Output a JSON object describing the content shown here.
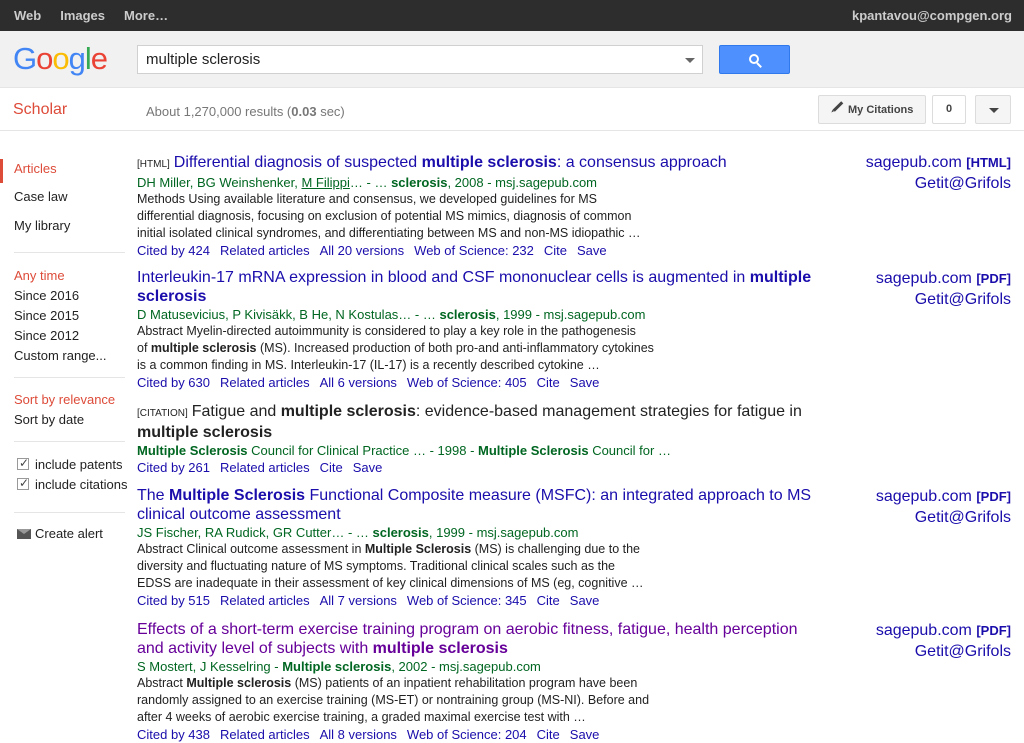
{
  "topbar": {
    "nav": [
      "Web",
      "Images",
      "More…"
    ],
    "user": "kpantavou@compgen.org"
  },
  "logo": {
    "letters": [
      "G",
      "o",
      "o",
      "g",
      "l",
      "e"
    ]
  },
  "search": {
    "value": "multiple sclerosis"
  },
  "scholar": {
    "title": "Scholar",
    "count_prefix": "About 1,270,000 results (",
    "count_time": "0.03",
    "count_suffix": " sec)",
    "my_citations": "My Citations",
    "counter": "0"
  },
  "sidebar": {
    "types": [
      "Articles",
      "Case law",
      "My library"
    ],
    "time": [
      "Any time",
      "Since 2016",
      "Since 2015",
      "Since 2012",
      "Custom range..."
    ],
    "sort": [
      "Sort by relevance",
      "Sort by date"
    ],
    "checks": [
      "include patents",
      "include citations"
    ],
    "alert": "Create alert"
  },
  "results": [
    {
      "tag": "[HTML]",
      "title_parts": [
        "Differential diagnosis of suspected ",
        "multiple sclerosis",
        ": a consensus approach"
      ],
      "authors_parts": [
        "DH Miller, BG Weinshenker, ",
        "M Filippi",
        "… - … ",
        "sclerosis",
        ", 2008 - msj.sagepub.com"
      ],
      "snippet_lines": [
        "Methods Using available literature and consensus, we developed guidelines for MS",
        "differential diagnosis, focusing on exclusion of potential MS mimics, diagnosis of common",
        "initial isolated clinical syndromes, and differentiating between MS and non-MS idiopathic …"
      ],
      "links": [
        "Cited by 424",
        "Related articles",
        "All 20 versions",
        "Web of Science: 232",
        "Cite",
        "Save"
      ],
      "side_source": "sagepub.com",
      "side_format": "[HTML]",
      "side_getit": "Getit@Grifols"
    },
    {
      "tag": "",
      "title_line1": [
        "Interleukin-17 mRNA expression in blood and CSF mononuclear cells is augmented in ",
        "multiple"
      ],
      "title_line2": "sclerosis",
      "authors_parts": [
        "D Matusevicius, P Kivisäkk, B He, N Kostulas… - … ",
        "sclerosis",
        ", 1999 - msj.sagepub.com"
      ],
      "snippet_lines": [
        "Abstract Myelin-directed autoimmunity is considered to play a key role in the pathogenesis",
        [
          "of ",
          "multiple sclerosis",
          " (MS). Increased production of both pro-and anti-inflammatory cytokines"
        ],
        "is a common finding in MS. Interleukin-17 (IL-17) is a recently described cytokine …"
      ],
      "links": [
        "Cited by 630",
        "Related articles",
        "All 6 versions",
        "Web of Science: 405",
        "Cite",
        "Save"
      ],
      "side_source": "sagepub.com",
      "side_format": "[PDF]",
      "side_getit": "Getit@Grifols"
    },
    {
      "tag": "[CITATION]",
      "title_line1": [
        "Fatigue and ",
        "multiple sclerosis",
        ": evidence-based management strategies for fatigue in"
      ],
      "title_line2": "multiple sclerosis",
      "authors_parts": [
        "Multiple Sclerosis",
        " Council for Clinical Practice … - 1998 - ",
        "Multiple Sclerosis",
        " Council for …"
      ],
      "links": [
        "Cited by 261",
        "Related articles",
        "Cite",
        "Save"
      ]
    },
    {
      "title_line1": [
        "The ",
        "Multiple Sclerosis",
        " Functional Composite measure (MSFC): an integrated approach to MS"
      ],
      "title_line2": "clinical outcome assessment",
      "authors_parts": [
        "JS Fischer, RA Rudick, GR Cutter… - … ",
        "sclerosis",
        ", 1999 - msj.sagepub.com"
      ],
      "snippet_lines": [
        [
          "Abstract Clinical outcome assessment in ",
          "Multiple Sclerosis",
          " (MS) is challenging due to the"
        ],
        "diversity and fluctuating nature of MS symptoms. Traditional clinical scales such as the",
        "EDSS are inadequate in their assessment of key clinical dimensions of MS (eg, cognitive …"
      ],
      "links": [
        "Cited by 515",
        "Related articles",
        "All 7 versions",
        "Web of Science: 345",
        "Cite",
        "Save"
      ],
      "side_source": "sagepub.com",
      "side_format": "[PDF]",
      "side_getit": "Getit@Grifols"
    },
    {
      "title_line1": "Effects of a short-term exercise training program on aerobic fitness, fatigue, health perception",
      "title_line2": [
        "and activity level of subjects with ",
        "multiple sclerosis"
      ],
      "authors_parts": [
        "S Mostert, J Kesselring - ",
        "Multiple sclerosis",
        ", 2002 - msj.sagepub.com"
      ],
      "snippet_lines": [
        [
          "Abstract ",
          "Multiple sclerosis",
          " (MS) patients of an inpatient rehabilitation program have been"
        ],
        "randomly assigned to an exercise training (MS-ET) or nontraining group (MS-NI). Before and",
        "after 4 weeks of aerobic exercise training, a graded maximal exercise test with …"
      ],
      "links": [
        "Cited by 438",
        "Related articles",
        "All 8 versions",
        "Web of Science: 204",
        "Cite",
        "Save"
      ],
      "side_source": "sagepub.com",
      "side_format": "[PDF]",
      "side_getit": "Getit@Grifols"
    }
  ]
}
